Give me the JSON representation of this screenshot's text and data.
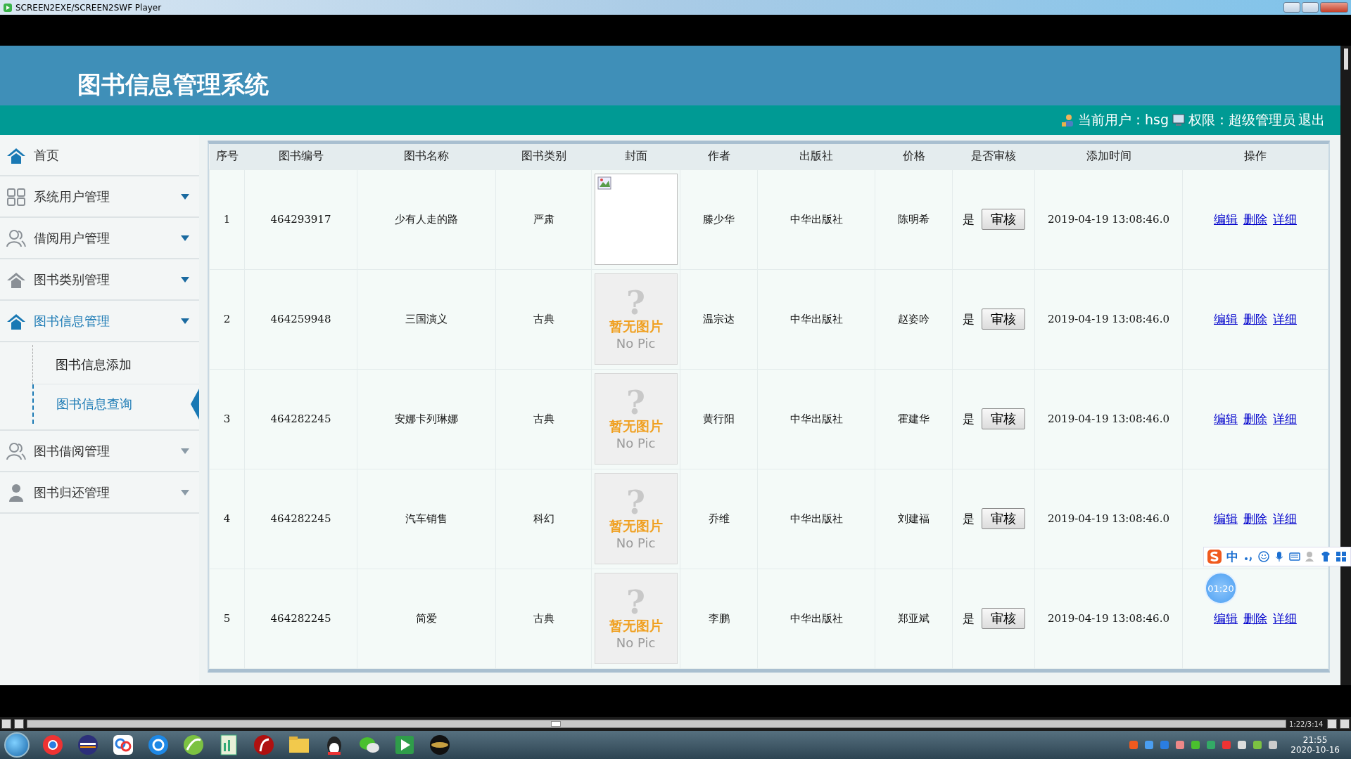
{
  "player_window": {
    "title": "SCREEN2EXE/SCREEN2SWF Player"
  },
  "app": {
    "title": "图书信息管理系统",
    "user_label": "当前用户：hsg",
    "role_label": "权限：超级管理员",
    "logout": "退出"
  },
  "sidebar": {
    "items": [
      {
        "label": "首页",
        "kind": "link",
        "selected": false
      },
      {
        "label": "系统用户管理",
        "kind": "menu",
        "selected": false
      },
      {
        "label": "借阅用户管理",
        "kind": "menu",
        "selected": false
      },
      {
        "label": "图书类别管理",
        "kind": "menu",
        "selected": false
      },
      {
        "label": "图书信息管理",
        "kind": "menu",
        "selected": true,
        "children": [
          {
            "label": "图书信息添加",
            "selected": false
          },
          {
            "label": "图书信息查询",
            "selected": true
          }
        ]
      },
      {
        "label": "图书借阅管理",
        "kind": "menu",
        "selected": false
      },
      {
        "label": "图书归还管理",
        "kind": "menu",
        "selected": false
      }
    ]
  },
  "table": {
    "columns": [
      "序号",
      "图书编号",
      "图书名称",
      "图书类别",
      "封面",
      "作者",
      "出版社",
      "价格",
      "是否审核",
      "添加时间",
      "操作"
    ],
    "rows": [
      {
        "no": "1",
        "code": "464293917",
        "name": "少有人走的路",
        "category": "严肃",
        "cover": {
          "kind": "broken"
        },
        "author": "滕少华",
        "publisher": "中华出版社",
        "price": "陈明希",
        "audited": "是",
        "audit_button": "审核",
        "added": "2019-04-19 13:08:46.0",
        "actions": [
          "编辑",
          "删除",
          "详细"
        ]
      },
      {
        "no": "2",
        "code": "464259948",
        "name": "三国演义",
        "category": "古典",
        "cover": {
          "kind": "no-pic",
          "mark": "?",
          "caption": "暂无图片",
          "subcaption": "No Pic"
        },
        "author": "温宗达",
        "publisher": "中华出版社",
        "price": "赵姿吟",
        "audited": "是",
        "audit_button": "审核",
        "added": "2019-04-19 13:08:46.0",
        "actions": [
          "编辑",
          "删除",
          "详细"
        ]
      },
      {
        "no": "3",
        "code": "464282245",
        "name": "安娜卡列琳娜",
        "category": "古典",
        "cover": {
          "kind": "no-pic",
          "mark": "?",
          "caption": "暂无图片",
          "subcaption": "No Pic"
        },
        "author": "黄行阳",
        "publisher": "中华出版社",
        "price": "霍建华",
        "audited": "是",
        "audit_button": "审核",
        "added": "2019-04-19 13:08:46.0",
        "actions": [
          "编辑",
          "删除",
          "详细"
        ]
      },
      {
        "no": "4",
        "code": "464282245",
        "name": "汽车销售",
        "category": "科幻",
        "cover": {
          "kind": "no-pic",
          "mark": "?",
          "caption": "暂无图片",
          "subcaption": "No Pic"
        },
        "author": "乔维",
        "publisher": "中华出版社",
        "price": "刘建福",
        "audited": "是",
        "audit_button": "审核",
        "added": "2019-04-19 13:08:46.0",
        "actions": [
          "编辑",
          "删除",
          "详细"
        ]
      },
      {
        "no": "5",
        "code": "464282245",
        "name": "简爱",
        "category": "古典",
        "cover": {
          "kind": "no-pic",
          "mark": "?",
          "caption": "暂无图片",
          "subcaption": "No Pic"
        },
        "author": "李鹏",
        "publisher": "中华出版社",
        "price": "郑亚斌",
        "audited": "是",
        "audit_button": "审核",
        "added": "2019-04-19 13:08:46.0",
        "actions": [
          "编辑",
          "删除",
          "详细"
        ]
      }
    ]
  },
  "ime_bar": {
    "mode": "中"
  },
  "timer": {
    "time": "01:20"
  },
  "player": {
    "time": "1:22/3:14",
    "level": 0.42
  },
  "taskbar": {
    "time": "21:55",
    "date": "2020-10-16"
  }
}
